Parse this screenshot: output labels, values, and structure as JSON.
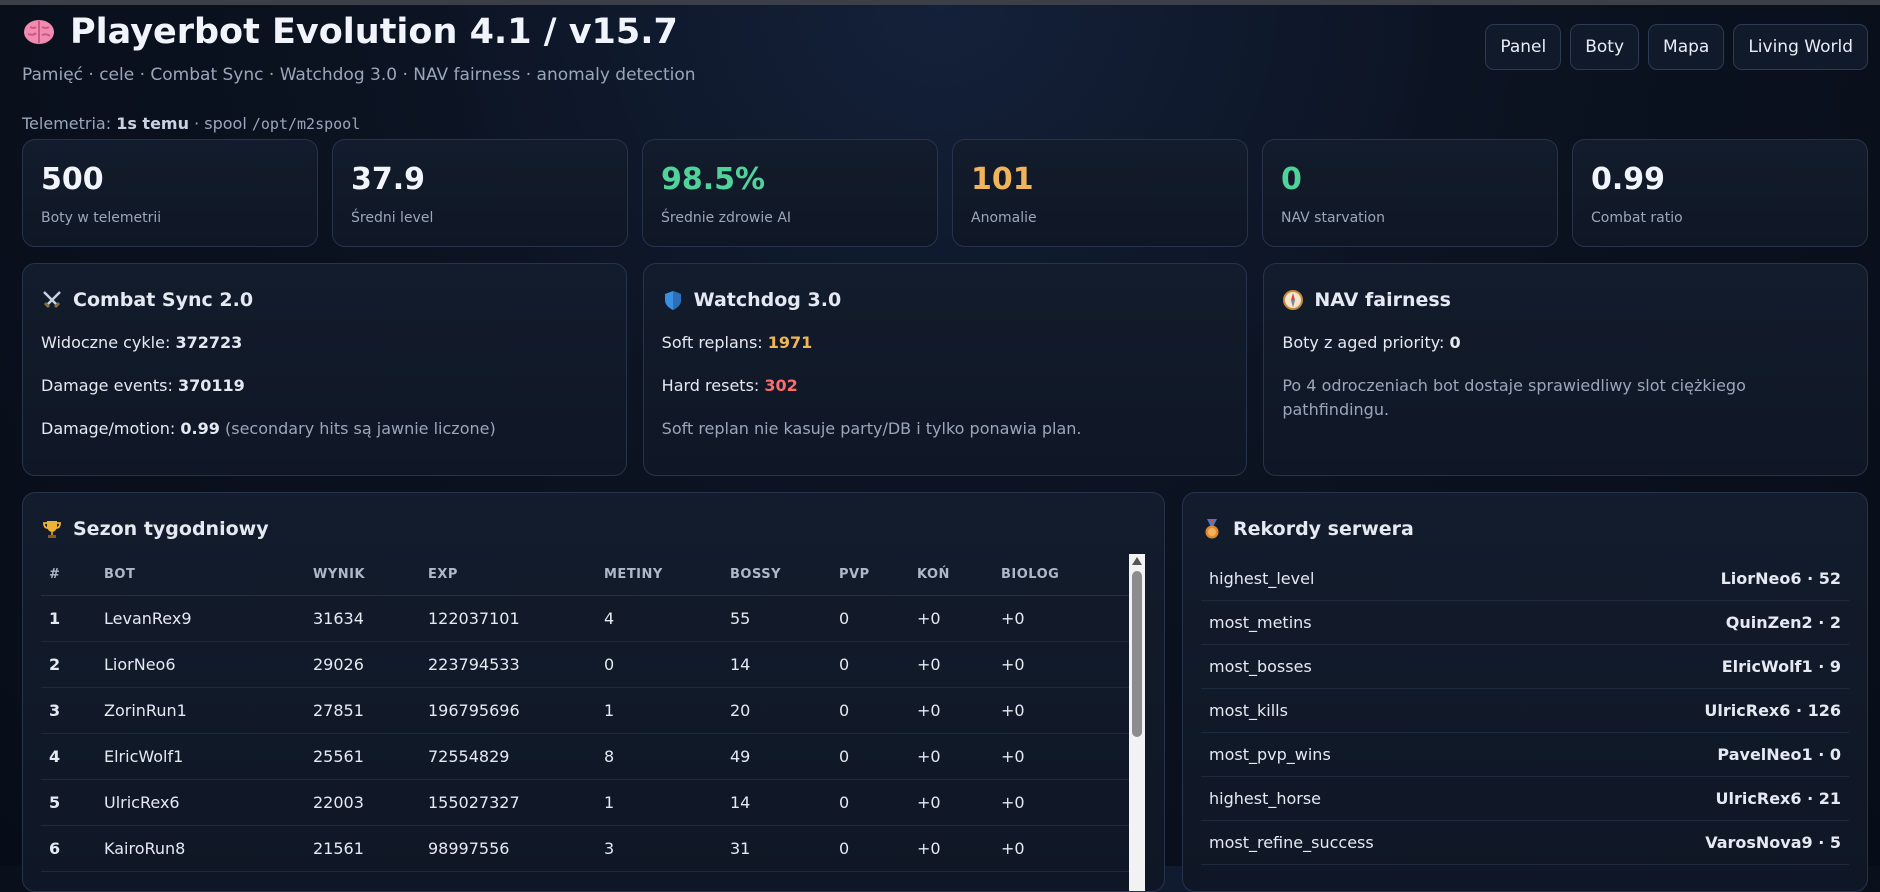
{
  "header": {
    "title": "Playerbot Evolution 4.1 / v15.7",
    "subtitle": "Pamięć · cele · Combat Sync · Watchdog 3.0 · NAV fairness · anomaly detection"
  },
  "nav": [
    "Panel",
    "Boty",
    "Mapa",
    "Living World"
  ],
  "telemetry": {
    "label": "Telemetria:",
    "age": "1s temu",
    "spool_label": "· spool",
    "spool_path": "/opt/m2spool"
  },
  "stats": [
    {
      "value": "500",
      "label": "Boty w telemetrii",
      "color": "#f1f4fa"
    },
    {
      "value": "37.9",
      "label": "Średni level",
      "color": "#f1f4fa"
    },
    {
      "value": "98.5%",
      "label": "Średnie zdrowie AI",
      "color": "#4fd39a"
    },
    {
      "value": "101",
      "label": "Anomalie",
      "color": "#f0b55a"
    },
    {
      "value": "0",
      "label": "NAV starvation",
      "color": "#4fd39a"
    },
    {
      "value": "0.99",
      "label": "Combat ratio",
      "color": "#f1f4fa"
    }
  ],
  "combat": {
    "title": "Combat Sync 2.0",
    "icon": "crossed-swords-icon",
    "cycles_label": "Widoczne cykle:",
    "cycles": "372723",
    "damage_label": "Damage events:",
    "damage": "370119",
    "ratio_label": "Damage/motion:",
    "ratio": "0.99",
    "ratio_note": "(secondary hits są jawnie liczone)"
  },
  "watchdog": {
    "title": "Watchdog 3.0",
    "icon": "shield-icon",
    "soft_label": "Soft replans:",
    "soft": "1971",
    "hard_label": "Hard resets:",
    "hard": "302",
    "note": "Soft replan nie kasuje party/DB i tylko ponawia plan."
  },
  "navfair": {
    "title": "NAV fairness",
    "icon": "compass-icon",
    "aged_label": "Boty z aged priority:",
    "aged": "0",
    "note": "Po 4 odroczeniach bot dostaje sprawiedliwy slot ciężkiego pathfindingu."
  },
  "season": {
    "title": "Sezon tygodniowy",
    "icon": "trophy-icon",
    "columns": [
      "#",
      "BOT",
      "WYNIK",
      "EXP",
      "METINY",
      "BOSSY",
      "PVP",
      "KOŃ",
      "BIOLOG"
    ],
    "rows": [
      [
        "1",
        "LevanRex9",
        "31634",
        "122037101",
        "4",
        "55",
        "0",
        "+0",
        "+0"
      ],
      [
        "2",
        "LiorNeo6",
        "29026",
        "223794533",
        "0",
        "14",
        "0",
        "+0",
        "+0"
      ],
      [
        "3",
        "ZorinRun1",
        "27851",
        "196795696",
        "1",
        "20",
        "0",
        "+0",
        "+0"
      ],
      [
        "4",
        "ElricWolf1",
        "25561",
        "72554829",
        "8",
        "49",
        "0",
        "+0",
        "+0"
      ],
      [
        "5",
        "UlricRex6",
        "22003",
        "155027327",
        "1",
        "14",
        "0",
        "+0",
        "+0"
      ],
      [
        "6",
        "KairoRun8",
        "21561",
        "98997556",
        "3",
        "31",
        "0",
        "+0",
        "+0"
      ]
    ]
  },
  "records": {
    "title": "Rekordy serwera",
    "icon": "medal-icon",
    "rows": [
      {
        "key": "highest_level",
        "value": "LiorNeo6 · 52"
      },
      {
        "key": "most_metins",
        "value": "QuinZen2 · 2"
      },
      {
        "key": "most_bosses",
        "value": "ElricWolf1 · 9"
      },
      {
        "key": "most_kills",
        "value": "UlricRex6 · 126"
      },
      {
        "key": "most_pvp_wins",
        "value": "PavelNeo1 · 0"
      },
      {
        "key": "highest_horse",
        "value": "UlricRex6 · 21"
      },
      {
        "key": "most_refine_success",
        "value": "VarosNova9 · 5"
      }
    ]
  }
}
